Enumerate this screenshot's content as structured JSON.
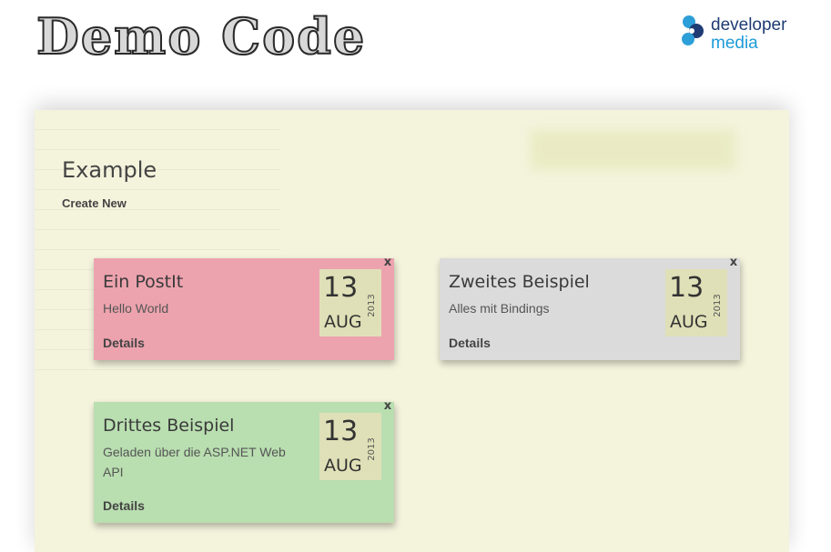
{
  "header": {
    "site_title": "Demo Code",
    "brand_line1": "developer",
    "brand_line2": "media"
  },
  "page": {
    "heading": "Example",
    "create_new": "Create New"
  },
  "notes": [
    {
      "title": "Ein PostIt",
      "text": "Hello World",
      "details": "Details",
      "close": "x",
      "day": "13",
      "month": "AUG",
      "year": "2013",
      "color": "#eca3ae"
    },
    {
      "title": "Zweites Beispiel",
      "text": "Alles mit Bindings",
      "details": "Details",
      "close": "x",
      "day": "13",
      "month": "AUG",
      "year": "2013",
      "color": "#dbdbdb"
    },
    {
      "title": "Drittes Beispiel",
      "text": "Geladen über die ASP.NET Web API",
      "details": "Details",
      "close": "x",
      "day": "13",
      "month": "AUG",
      "year": "2013",
      "color": "#b9deb0"
    }
  ],
  "colors": {
    "paper": "#f4f3dc",
    "date_badge": "#e0e0b8",
    "brand_dark": "#1f3c74",
    "brand_light": "#1f9bd7"
  },
  "icons": {
    "brand_logo": "developer-media-logo",
    "close": "close-icon"
  }
}
